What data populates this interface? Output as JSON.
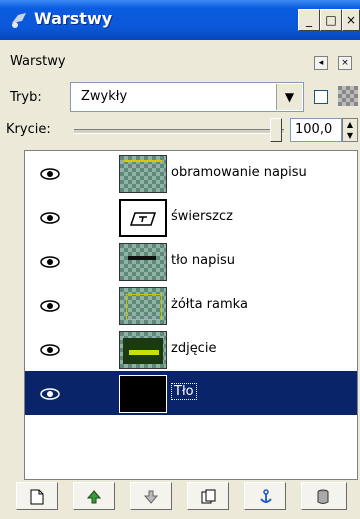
{
  "window": {
    "title": "Warstwy",
    "min_glyph": "_",
    "max_glyph": "□",
    "close_glyph": "×"
  },
  "panel": {
    "header": "Warstwy"
  },
  "mode": {
    "label": "Tryb:",
    "value": "Zwykły"
  },
  "opacity": {
    "label": "Krycie:",
    "value": "100,0",
    "percent": 100
  },
  "layers": [
    {
      "name": "obramowanie napisu",
      "thumb": "checker-yellow-line",
      "visible": true,
      "selected": false
    },
    {
      "name": "świerszcz",
      "thumb": "text-icon",
      "visible": true,
      "selected": false
    },
    {
      "name": "tło napisu",
      "thumb": "checker-black-bar",
      "visible": true,
      "selected": false
    },
    {
      "name": "żółta ramka",
      "thumb": "checker-yellow-frame",
      "visible": true,
      "selected": false
    },
    {
      "name": "zdjęcie",
      "thumb": "photo",
      "visible": true,
      "selected": false
    },
    {
      "name": "Tło",
      "thumb": "black",
      "visible": true,
      "selected": true
    }
  ],
  "toolbar": [
    {
      "icon": "new-layer-icon"
    },
    {
      "icon": "raise-layer-icon"
    },
    {
      "icon": "lower-layer-icon"
    },
    {
      "icon": "duplicate-layer-icon"
    },
    {
      "icon": "anchor-layer-icon"
    },
    {
      "icon": "delete-layer-icon"
    }
  ],
  "colors": {
    "titlebar": "#0b57d8",
    "selection": "#0a246a",
    "panel": "#ece9d8"
  }
}
